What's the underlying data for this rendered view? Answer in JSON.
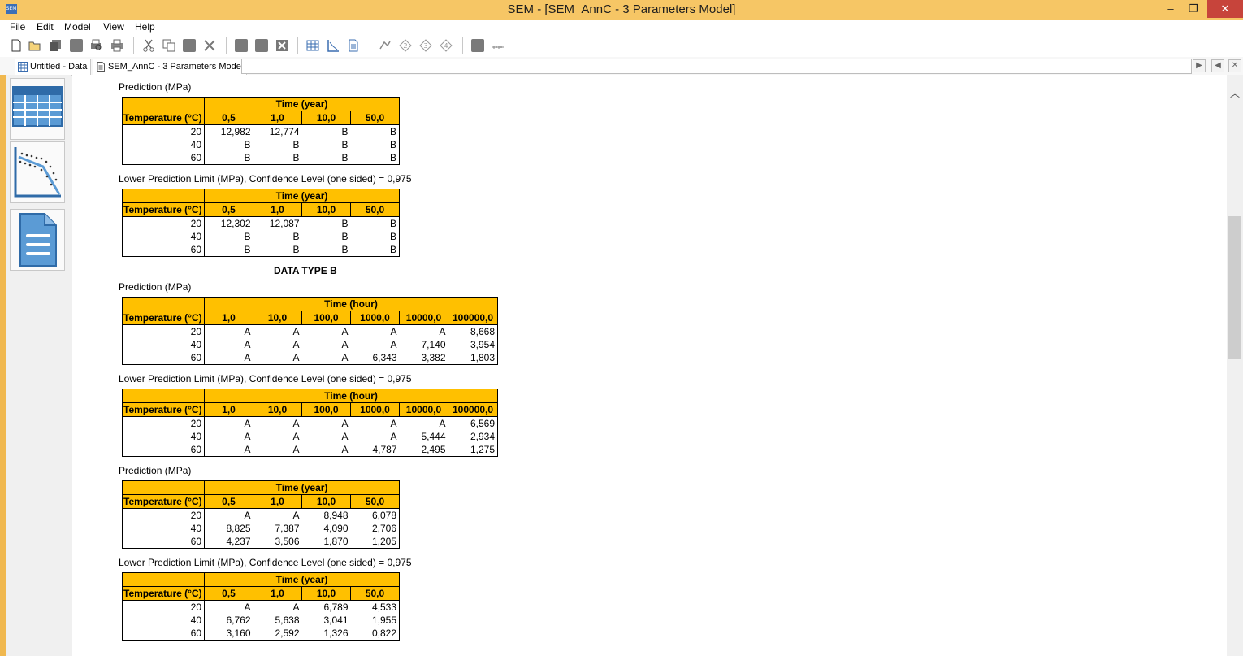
{
  "window": {
    "app_icon_text": "SEM",
    "title": "SEM - [SEM_AnnC - 3 Parameters Model]",
    "minimize": "‒",
    "maximize": "❐",
    "close": "✕"
  },
  "menu": [
    "File",
    "Edit",
    "Model",
    "View",
    "Help"
  ],
  "tabs": [
    {
      "label": "Untitled - Data",
      "icon": "grid-icon"
    },
    {
      "label": "SEM_AnnC - 3 Parameters Model",
      "icon": "document-icon"
    }
  ],
  "tab_nav": {
    "next": "▶",
    "prev": "◀",
    "close": "✕"
  },
  "side_panel": [
    "data-table-icon",
    "regression-chart-icon",
    "report-document-icon"
  ],
  "colors": {
    "header": "#ffc000",
    "title_bar": "#f6c665",
    "accent": "#f0b84f"
  },
  "labels": {
    "prediction": "Prediction (MPa)",
    "lower_limit": "Lower Prediction Limit (MPa), Confidence Level (one sided) = 0,975",
    "data_type_b": "DATA TYPE B",
    "temp_header": "Temperature (°C)",
    "time_year": "Time (year)",
    "time_hour": "Time (hour)"
  },
  "tables": [
    {
      "time_cols": [
        "0,5",
        "1,0",
        "10,0",
        "50,0"
      ],
      "rows": [
        {
          "t": "20",
          "v": [
            "12,982",
            "12,774",
            "B",
            "B"
          ]
        },
        {
          "t": "40",
          "v": [
            "B",
            "B",
            "B",
            "B"
          ]
        },
        {
          "t": "60",
          "v": [
            "B",
            "B",
            "B",
            "B"
          ]
        }
      ]
    },
    {
      "time_cols": [
        "0,5",
        "1,0",
        "10,0",
        "50,0"
      ],
      "rows": [
        {
          "t": "20",
          "v": [
            "12,302",
            "12,087",
            "B",
            "B"
          ]
        },
        {
          "t": "40",
          "v": [
            "B",
            "B",
            "B",
            "B"
          ]
        },
        {
          "t": "60",
          "v": [
            "B",
            "B",
            "B",
            "B"
          ]
        }
      ]
    },
    {
      "time_cols": [
        "1,0",
        "10,0",
        "100,0",
        "1000,0",
        "10000,0",
        "100000,0"
      ],
      "rows": [
        {
          "t": "20",
          "v": [
            "A",
            "A",
            "A",
            "A",
            "A",
            "8,668"
          ]
        },
        {
          "t": "40",
          "v": [
            "A",
            "A",
            "A",
            "A",
            "7,140",
            "3,954"
          ]
        },
        {
          "t": "60",
          "v": [
            "A",
            "A",
            "A",
            "6,343",
            "3,382",
            "1,803"
          ]
        }
      ]
    },
    {
      "time_cols": [
        "1,0",
        "10,0",
        "100,0",
        "1000,0",
        "10000,0",
        "100000,0"
      ],
      "rows": [
        {
          "t": "20",
          "v": [
            "A",
            "A",
            "A",
            "A",
            "A",
            "6,569"
          ]
        },
        {
          "t": "40",
          "v": [
            "A",
            "A",
            "A",
            "A",
            "5,444",
            "2,934"
          ]
        },
        {
          "t": "60",
          "v": [
            "A",
            "A",
            "A",
            "4,787",
            "2,495",
            "1,275"
          ]
        }
      ]
    },
    {
      "time_cols": [
        "0,5",
        "1,0",
        "10,0",
        "50,0"
      ],
      "rows": [
        {
          "t": "20",
          "v": [
            "A",
            "A",
            "8,948",
            "6,078"
          ]
        },
        {
          "t": "40",
          "v": [
            "8,825",
            "7,387",
            "4,090",
            "2,706"
          ]
        },
        {
          "t": "60",
          "v": [
            "4,237",
            "3,506",
            "1,870",
            "1,205"
          ]
        }
      ]
    },
    {
      "time_cols": [
        "0,5",
        "1,0",
        "10,0",
        "50,0"
      ],
      "rows": [
        {
          "t": "20",
          "v": [
            "A",
            "A",
            "6,789",
            "4,533"
          ]
        },
        {
          "t": "40",
          "v": [
            "6,762",
            "5,638",
            "3,041",
            "1,955"
          ]
        },
        {
          "t": "60",
          "v": [
            "3,160",
            "2,592",
            "1,326",
            "0,822"
          ]
        }
      ]
    }
  ]
}
